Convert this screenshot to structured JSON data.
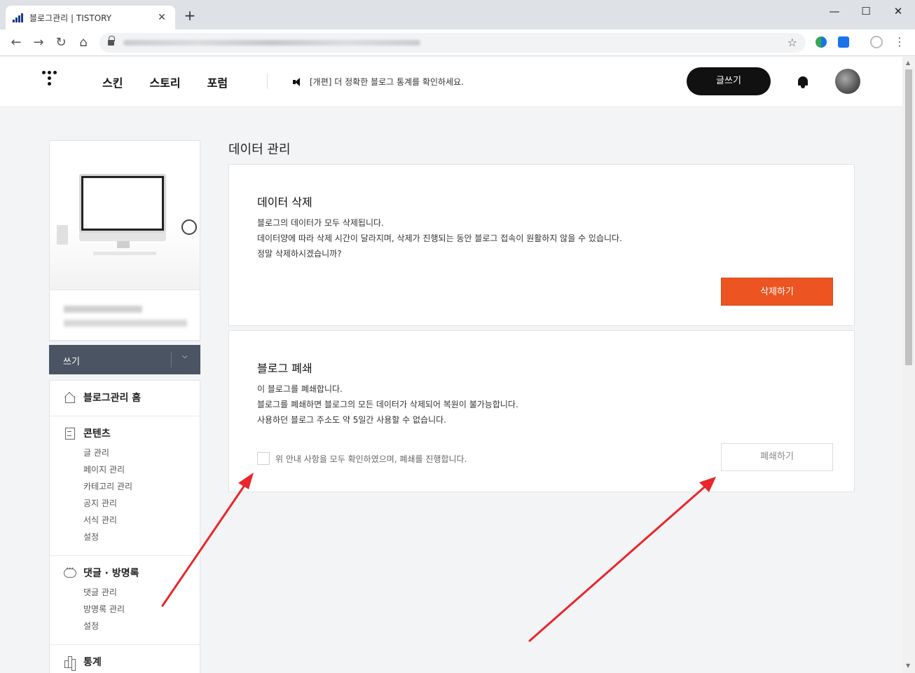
{
  "browser": {
    "tab_title": "블로그관리 | TISTORY",
    "tab_close": "✕",
    "new_tab": "+",
    "back": "←",
    "forward": "→",
    "reload": "↻",
    "home": "⌂",
    "bookmark_star": "☆",
    "minimize": "—",
    "maximize": "☐",
    "close": "✕",
    "menu": "⋮"
  },
  "header": {
    "nav": [
      "스킨",
      "스토리",
      "포럼"
    ],
    "notice": "[개편] 더 정확한 블로그 통계를 확인하세요.",
    "write_button": "글쓰기"
  },
  "sidebar": {
    "write_label": "쓰기",
    "write_chevron": "⌵",
    "sections": [
      {
        "icon": "home-icon",
        "title": "블로그관리 홈",
        "items": []
      },
      {
        "icon": "document-icon",
        "title": "콘텐츠",
        "items": [
          "글 관리",
          "페이지 관리",
          "카테고리 관리",
          "공지 관리",
          "서식 관리",
          "설정"
        ]
      },
      {
        "icon": "comment-icon",
        "title": "댓글 · 방명록",
        "items": [
          "댓글 관리",
          "방명록 관리",
          "설정"
        ]
      },
      {
        "icon": "statistics-icon",
        "title": "통계",
        "items": []
      }
    ]
  },
  "main": {
    "page_title": "데이터 관리",
    "delete_panel": {
      "title": "데이터 삭제",
      "lines": [
        "블로그의 데이터가 모두 삭제됩니다.",
        "데이터양에 따라 삭제 시간이 달라지며, 삭제가 진행되는 동안 블로그 접속이 원활하지 않을 수 있습니다.",
        "정말 삭제하시겠습니까?"
      ],
      "button": "삭제하기"
    },
    "close_panel": {
      "title": "블로그 폐쇄",
      "lines": [
        "이 블로그를 폐쇄합니다.",
        "블로그를 폐쇄하면 블로그의 모든 데이터가 삭제되어 복원이 불가능합니다.",
        "사용하던 블로그 주소도 약 5일간 사용할 수 없습니다."
      ],
      "confirm_label": "위 안내 사항을 모두 확인하였으며, 폐쇄를 진행합니다.",
      "confirm_checked": false,
      "button": "폐쇄하기"
    }
  },
  "colors": {
    "accent_delete": "#ec5421",
    "sidebar_write_bg": "#4a5463",
    "annotation_arrow": "#e8262b"
  }
}
